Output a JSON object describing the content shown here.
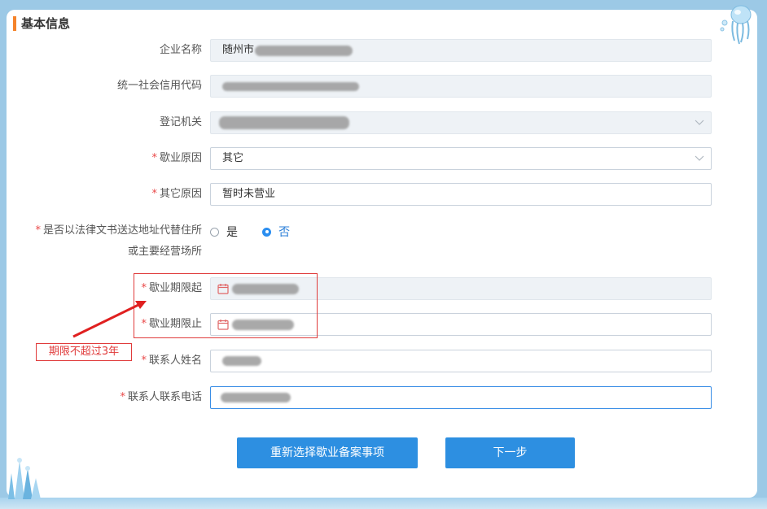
{
  "section": {
    "title": "基本信息"
  },
  "fields": {
    "company_name": {
      "label": "企业名称",
      "value_prefix": "随州市"
    },
    "credit_code": {
      "label": "统一社会信用代码"
    },
    "registry": {
      "label": "登记机关"
    },
    "closure_reason": {
      "label": "歇业原因",
      "value": "其它"
    },
    "other_reason": {
      "label": "其它原因",
      "value": "暂时未营业"
    },
    "legal_address": {
      "label_line1": "是否以法律文书送达地址代替住所",
      "label_line2": "或主要经营场所",
      "options": [
        "是",
        "否"
      ],
      "selected": "否"
    },
    "period_start": {
      "label": "歇业期限起"
    },
    "period_end": {
      "label": "歇业期限止"
    },
    "contact_name": {
      "label": "联系人姓名"
    },
    "contact_phone": {
      "label": "联系人联系电话"
    }
  },
  "required_mark": "*",
  "annotation": {
    "text": "期限不超过3年"
  },
  "buttons": {
    "reselect": "重新选择歇业备案事项",
    "next": "下一步"
  },
  "colors": {
    "accent": "#2d8fe1",
    "section_bar": "#f5832a",
    "required": "#e94848",
    "annotation": "#e03b3b"
  }
}
